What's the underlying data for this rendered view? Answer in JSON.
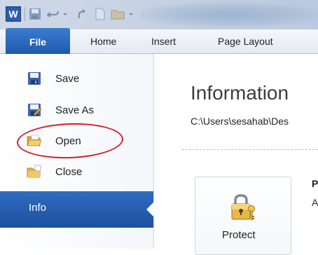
{
  "titlebar": {
    "app_icon_letter": "W"
  },
  "tabs": [
    {
      "label": "File"
    },
    {
      "label": "Home"
    },
    {
      "label": "Insert"
    },
    {
      "label": "Page Layout"
    }
  ],
  "backstage": {
    "menu": [
      {
        "label": "Save",
        "icon": "save-icon"
      },
      {
        "label": "Save As",
        "icon": "save-as-icon"
      },
      {
        "label": "Open",
        "icon": "open-folder-icon"
      },
      {
        "label": "Close",
        "icon": "close-folder-icon"
      }
    ],
    "selected": {
      "label": "Info"
    }
  },
  "content": {
    "title": "Information",
    "path": "C:\\Users\\sesahab\\Des",
    "protect_label": "Protect",
    "side_P": "P",
    "side_A": "A"
  },
  "colors": {
    "file_tab": "#2a67bf",
    "info_selected": "#2a63b4",
    "annotation_circle": "#d4202a"
  }
}
